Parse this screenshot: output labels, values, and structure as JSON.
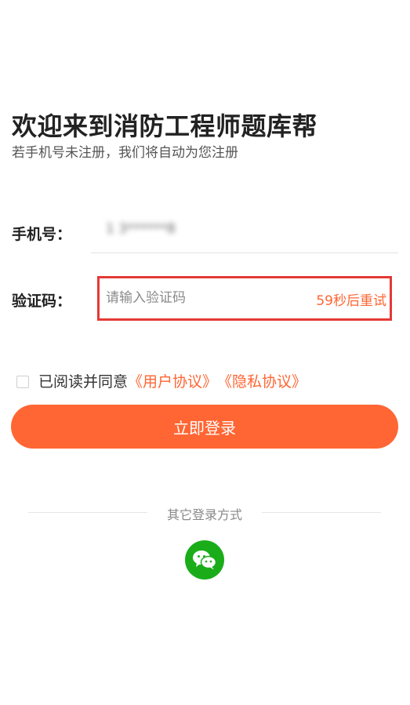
{
  "header": {
    "title": "欢迎来到消防工程师题库帮",
    "subtitle": "若手机号未注册，我们将自动为您注册"
  },
  "form": {
    "phone_label": "手机号：",
    "phone_value": "1 3******8",
    "code_label": "验证码：",
    "code_placeholder": "请输入验证码",
    "resend_label": "59秒后重试"
  },
  "agreement": {
    "prefix": "已阅读并同意",
    "user_agreement": "《用户协议》",
    "privacy_agreement": "《隐私协议》",
    "checked": false
  },
  "login_button_label": "立即登录",
  "other_login": {
    "label": "其它登录方式",
    "methods": [
      {
        "icon": "wechat-icon"
      }
    ]
  },
  "colors": {
    "accent": "#ff6633",
    "highlight_border": "#e53935",
    "wechat": "#1aad19"
  }
}
